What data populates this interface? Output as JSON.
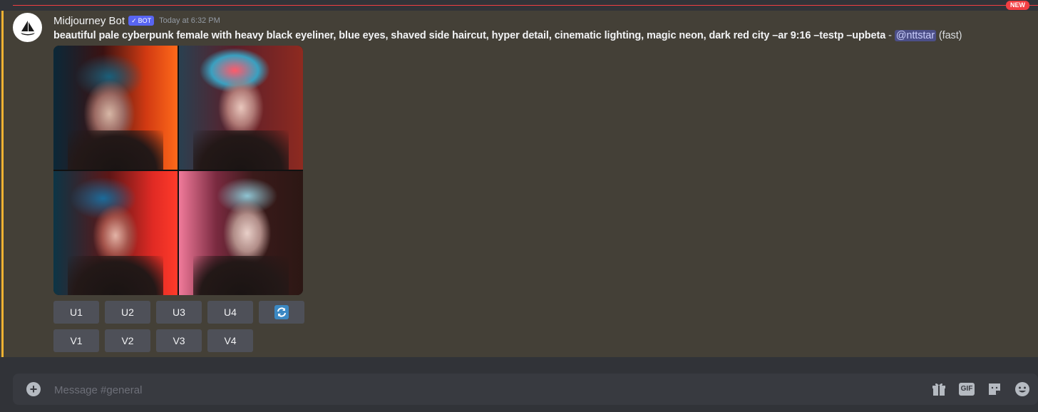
{
  "divider": {
    "new_label": "NEW"
  },
  "message": {
    "username": "Midjourney Bot",
    "bot_tag": "BOT",
    "bot_check": "✓",
    "timestamp": "Today at 6:32 PM",
    "prompt": "beautiful pale cyberpunk female with heavy black eyeliner, blue eyes, shaved side haircut, hyper detail, cinematic lighting, magic neon, dark red city –ar 9:16 –testp –upbeta",
    "separator": " - ",
    "mention": "@nttstar",
    "speed": " (fast)",
    "image_grid": {
      "alt": "4-image grid of cyberpunk portraits",
      "icon": "image-grid"
    },
    "buttons_row1": [
      "U1",
      "U2",
      "U3",
      "U4"
    ],
    "reroll_icon": "reroll-icon",
    "buttons_row2": [
      "V1",
      "V2",
      "V3",
      "V4"
    ]
  },
  "composer": {
    "placeholder": "Message #general",
    "gif_label": "GIF",
    "icons": [
      "plus-icon",
      "gift-icon",
      "gif-icon",
      "sticker-icon",
      "emoji-icon"
    ]
  },
  "colors": {
    "background": "#313338",
    "message_highlight": "#444037",
    "mention_bar": "#f0b232",
    "new_divider": "#f23f43",
    "button": "#4e5058",
    "bot_tag": "#5865f2"
  }
}
